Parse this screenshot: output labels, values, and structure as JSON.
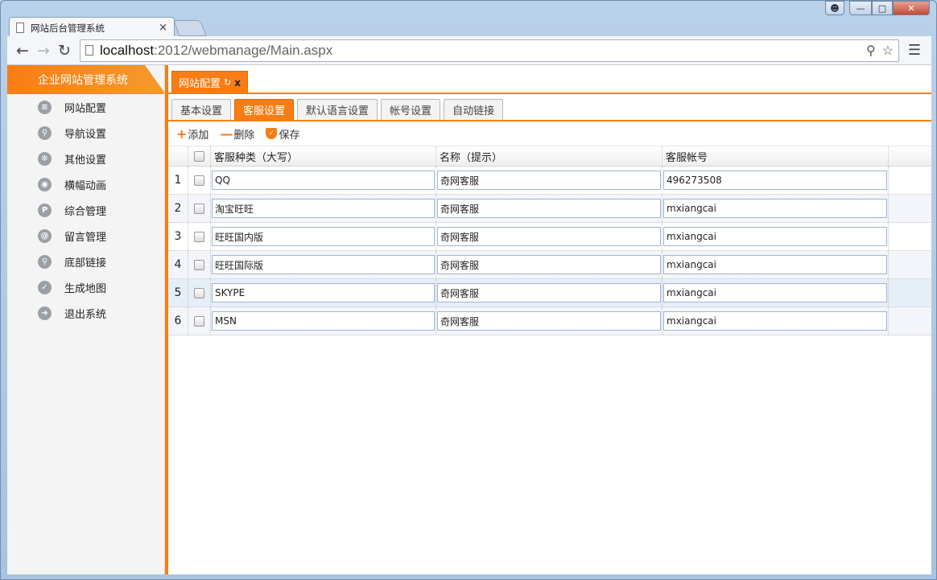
{
  "browser": {
    "tab_title": "网站后台管理系统",
    "tab_close": "×",
    "url_host": "localhost",
    "url_path": ":2012/webmanage/Main.aspx"
  },
  "sidebar": {
    "header": "企业网站管理系统",
    "items": [
      {
        "label": "网站配置",
        "icon": "list-icon",
        "glyph": "≡"
      },
      {
        "label": "导航设置",
        "icon": "link-icon",
        "glyph": "⚲"
      },
      {
        "label": "其他设置",
        "icon": "gear-icon",
        "glyph": "✲"
      },
      {
        "label": "横幅动画",
        "icon": "camera-icon",
        "glyph": "◉"
      },
      {
        "label": "综合管理",
        "icon": "p-icon",
        "glyph": "P"
      },
      {
        "label": "留言管理",
        "icon": "at-icon",
        "glyph": "@"
      },
      {
        "label": "底部链接",
        "icon": "link-icon",
        "glyph": "⚲"
      },
      {
        "label": "生成地图",
        "icon": "check-icon",
        "glyph": "✓"
      },
      {
        "label": "退出系统",
        "icon": "arrow-right-icon",
        "glyph": "➜"
      }
    ]
  },
  "main_tab": {
    "label": "网站配置",
    "refresh": "↻",
    "close": "x"
  },
  "sub_tabs": [
    "基本设置",
    "客服设置",
    "默认语言设置",
    "帐号设置",
    "自动链接"
  ],
  "actions": {
    "add": "添加",
    "delete": "删除",
    "save": "保存"
  },
  "grid": {
    "columns": [
      "客服种类（大写）",
      "名称（提示）",
      "客服帐号"
    ],
    "rows": [
      {
        "num": "1",
        "type": "QQ",
        "name": "奇网客服",
        "account": "496273508"
      },
      {
        "num": "2",
        "type": "淘宝旺旺",
        "name": "奇网客服",
        "account": "mxiangcai"
      },
      {
        "num": "3",
        "type": "旺旺国内版",
        "name": "奇网客服",
        "account": "mxiangcai"
      },
      {
        "num": "4",
        "type": "旺旺国际版",
        "name": "奇网客服",
        "account": "mxiangcai"
      },
      {
        "num": "5",
        "type": "SKYPE",
        "name": "奇网客服",
        "account": "mxiangcai"
      },
      {
        "num": "6",
        "type": "MSN",
        "name": "奇网客服",
        "account": "mxiangcai"
      }
    ]
  },
  "colors": {
    "accent": "#f87d14"
  }
}
